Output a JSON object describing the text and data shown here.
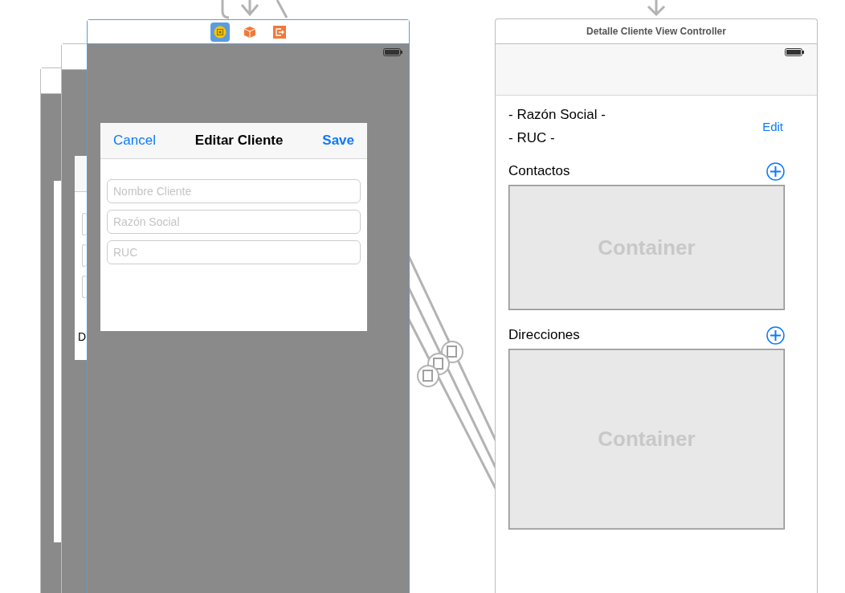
{
  "back_scene": {
    "label_fragment": "D"
  },
  "edit_scene": {
    "toolbar_icons": [
      {
        "kind": "controller",
        "selected": true
      },
      {
        "kind": "cube",
        "selected": false
      },
      {
        "kind": "exit",
        "selected": false
      }
    ],
    "nav_bar": {
      "cancel": "Cancel",
      "title": "Editar Cliente",
      "save": "Save"
    },
    "fields": [
      {
        "placeholder": "Nombre Cliente"
      },
      {
        "placeholder": "Razón Social"
      },
      {
        "placeholder": "RUC"
      }
    ]
  },
  "detail_scene": {
    "title": "Detalle Cliente View Controller",
    "razon_social": "- Razón Social -",
    "ruc": "- RUC -",
    "edit": "Edit",
    "sections": [
      {
        "title": "Contactos",
        "container": "Container"
      },
      {
        "title": "Direcciones",
        "container": "Container"
      }
    ]
  }
}
